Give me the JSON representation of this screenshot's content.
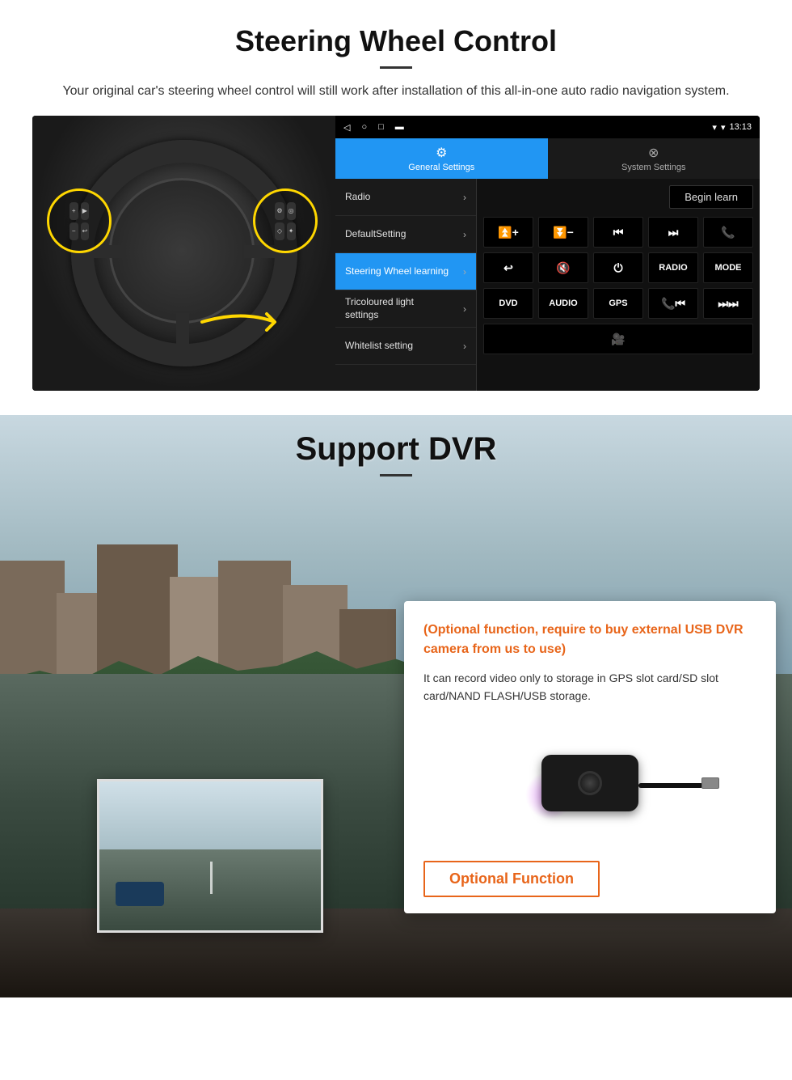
{
  "page": {
    "section1": {
      "title": "Steering Wheel Control",
      "subtitle": "Your original car's steering wheel control will still work after installation of this all-in-one auto radio navigation system.",
      "android": {
        "statusbar": {
          "time": "13:13",
          "signal_icon": "▾",
          "wifi_icon": "▾",
          "battery_icon": "▮"
        },
        "tabs": {
          "general_settings": "General Settings",
          "system_settings": "System Settings"
        },
        "menu_items": [
          {
            "label": "Radio",
            "active": false
          },
          {
            "label": "DefaultSetting",
            "active": false
          },
          {
            "label": "Steering Wheel learning",
            "active": true
          },
          {
            "label": "Tricoloured light settings",
            "active": false
          },
          {
            "label": "Whitelist setting",
            "active": false
          }
        ],
        "begin_learn_label": "Begin learn",
        "control_buttons": [
          [
            "vol+",
            "vol-",
            "prev",
            "next",
            "phone"
          ],
          [
            "hangup",
            "mute",
            "power",
            "RADIO",
            "MODE"
          ],
          [
            "DVD",
            "AUDIO",
            "GPS",
            "phone-prev",
            "skip"
          ]
        ]
      }
    },
    "section2": {
      "title": "Support DVR",
      "card": {
        "optional_text": "(Optional function, require to buy external USB DVR camera from us to use)",
        "desc_text": "It can record video only to storage in GPS slot card/SD slot card/NAND FLASH/USB storage.",
        "optional_function_label": "Optional Function"
      }
    }
  }
}
